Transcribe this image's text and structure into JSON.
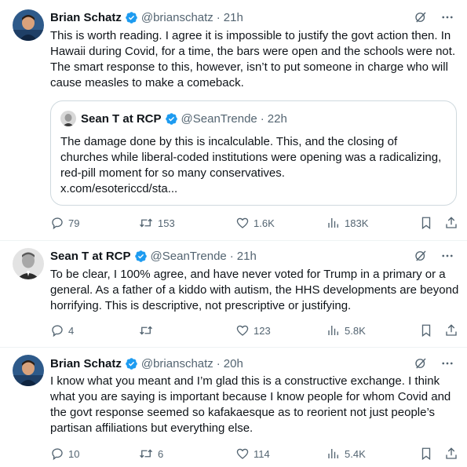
{
  "tweets": [
    {
      "name": "Brian Schatz",
      "handle": "@brianschatz",
      "dot": "·",
      "time": "21h",
      "text": "This is worth reading. I agree it is impossible to justify the govt action then. In Hawaii during Covid, for a time, the bars were open and the schools were not. The smart response to this, however, isn’t to put someone in charge who will cause measles to make a comeback.",
      "quote": {
        "name": "Sean T at RCP",
        "handle": "@SeanTrende",
        "dot": "·",
        "time": "22h",
        "text": "The damage done by this is incalculable.  This, and the closing of churches while liberal-coded institutions were opening was a radicalizing, red-pill moment for so many conservatives.",
        "link": "x.com/esotericcd/sta..."
      },
      "stats": {
        "replies": "79",
        "retweets": "153",
        "likes": "1.6K",
        "views": "183K"
      }
    },
    {
      "name": "Sean T at RCP",
      "handle": "@SeanTrende",
      "dot": "·",
      "time": "21h",
      "text": "To be clear, I 100% agree, and have never voted for Trump in a primary or a general. As a father of a kiddo with autism, the HHS developments are beyond horrifying. This is descriptive, not prescriptive or justifying.",
      "stats": {
        "replies": "4",
        "retweets": "",
        "likes": "123",
        "views": "5.8K"
      }
    },
    {
      "name": "Brian Schatz",
      "handle": "@brianschatz",
      "dot": "·",
      "time": "20h",
      "text": "I know what you meant and I’m glad this is a constructive exchange. I think what you are saying is important because I know  people for whom Covid and the govt response seemed so kafakaesque as to reorient not just people’s partisan affiliations but everything else.",
      "stats": {
        "replies": "10",
        "retweets": "6",
        "likes": "114",
        "views": "5.4K"
      }
    }
  ],
  "colors": {
    "text": "#0f1419",
    "muted": "#536471",
    "verified": "#1d9bf0",
    "border": "#cfd9de",
    "divider": "#eff3f4"
  },
  "icons": [
    "grok-icon",
    "more-icon",
    "reply-icon",
    "retweet-icon",
    "like-icon",
    "views-icon",
    "bookmark-icon",
    "share-icon",
    "verified-badge-icon"
  ]
}
